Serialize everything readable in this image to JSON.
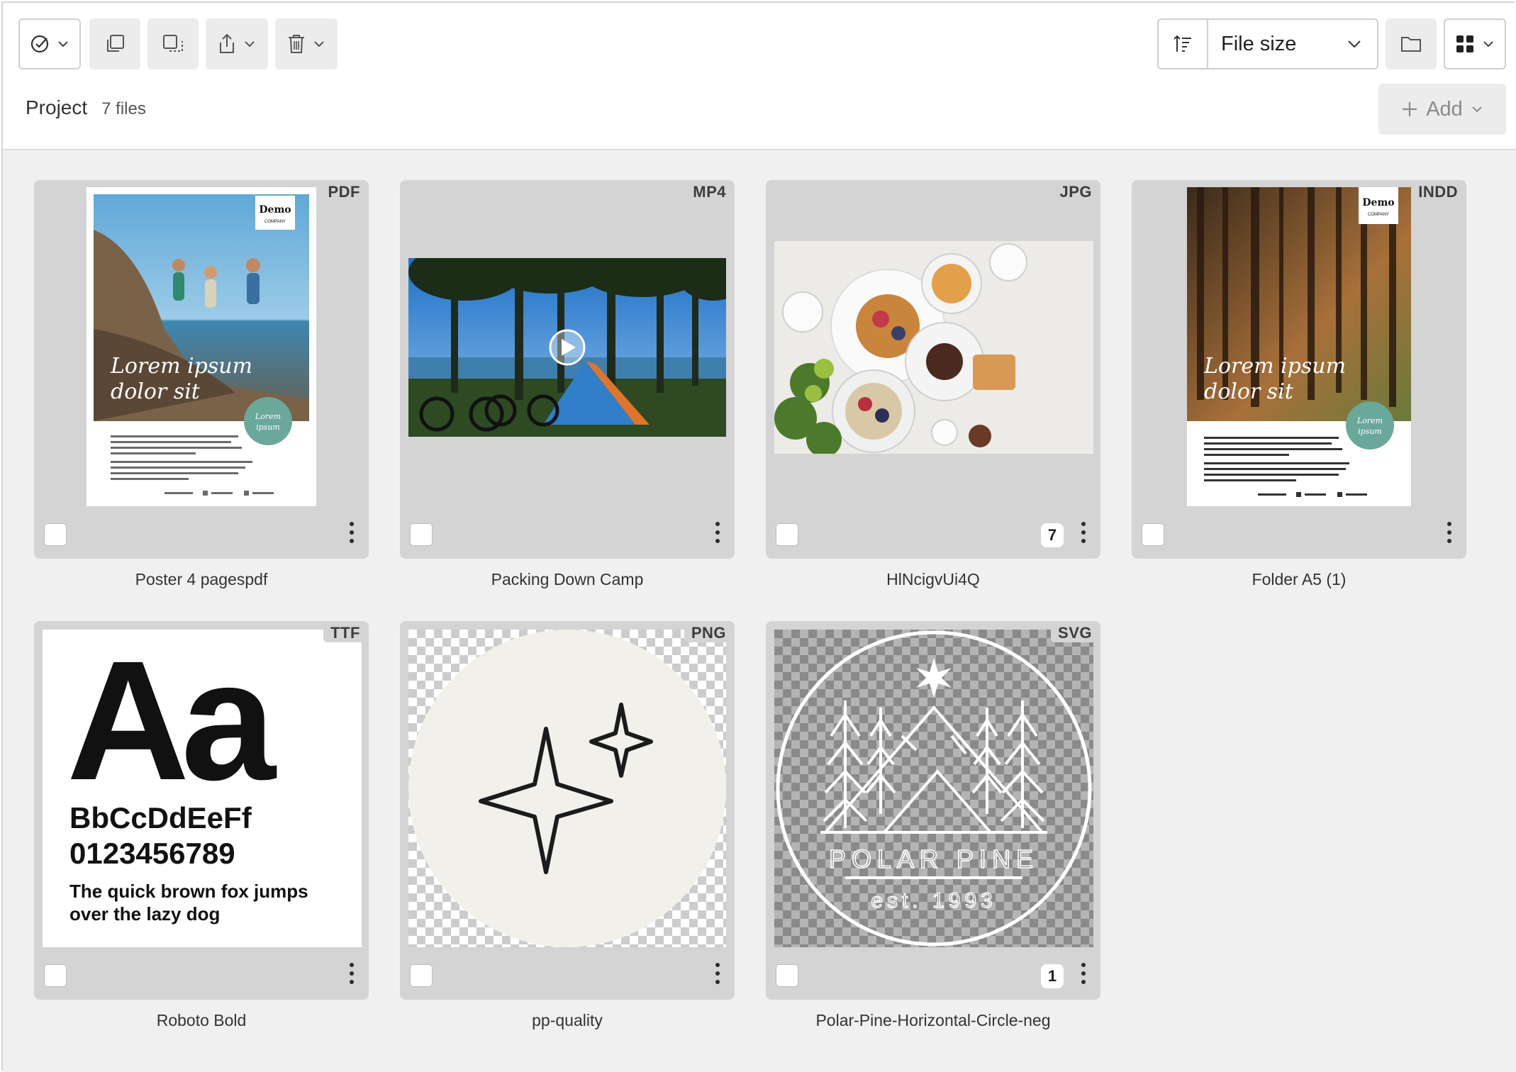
{
  "toolbar": {
    "sort_field": "File size",
    "add_label": "Add"
  },
  "project": {
    "title": "Project",
    "count": "7 files"
  },
  "assets": [
    {
      "name": "Poster 4 pagespdf",
      "type": "PDF",
      "badge": null
    },
    {
      "name": "Packing Down Camp",
      "type": "MP4",
      "badge": null
    },
    {
      "name": "HlNcigvUi4Q",
      "type": "JPG",
      "badge": "7"
    },
    {
      "name": "Folder A5 (1)",
      "type": "INDD",
      "badge": null
    },
    {
      "name": "Roboto Bold",
      "type": "TTF",
      "badge": null
    },
    {
      "name": "pp-quality",
      "type": "PNG",
      "badge": null
    },
    {
      "name": "Polar-Pine-Horizontal-Circle-neg",
      "type": "SVG",
      "badge": "1"
    }
  ],
  "thumbs": {
    "poster": {
      "logo": "Demo",
      "logo_sub": "COMPANY",
      "headline_1": "Lorem ipsum",
      "headline_2": "dolor sit",
      "circle_1": "Lorem",
      "circle_2": "ipsum"
    },
    "font": {
      "big": "Aa",
      "letters": "BbCcDdEeFf",
      "digits": "0123456789",
      "pangram_1": "The quick brown fox jumps",
      "pangram_2": "over the lazy dog"
    },
    "logo": {
      "brand": "POLAR PINE",
      "est": "est. 1993"
    }
  },
  "icons": [
    "check-select-icon",
    "duplicate-icon",
    "move-icon",
    "share-icon",
    "trash-icon",
    "sort-icon",
    "chevron-down-icon",
    "folder-icon",
    "grid-view-icon",
    "plus-icon",
    "play-icon",
    "kebab-menu-icon"
  ],
  "colors": {
    "accent_teal": "#6aa89a",
    "card_bg": "#d5d4d4",
    "gallery_bg": "#f0f0f0"
  }
}
